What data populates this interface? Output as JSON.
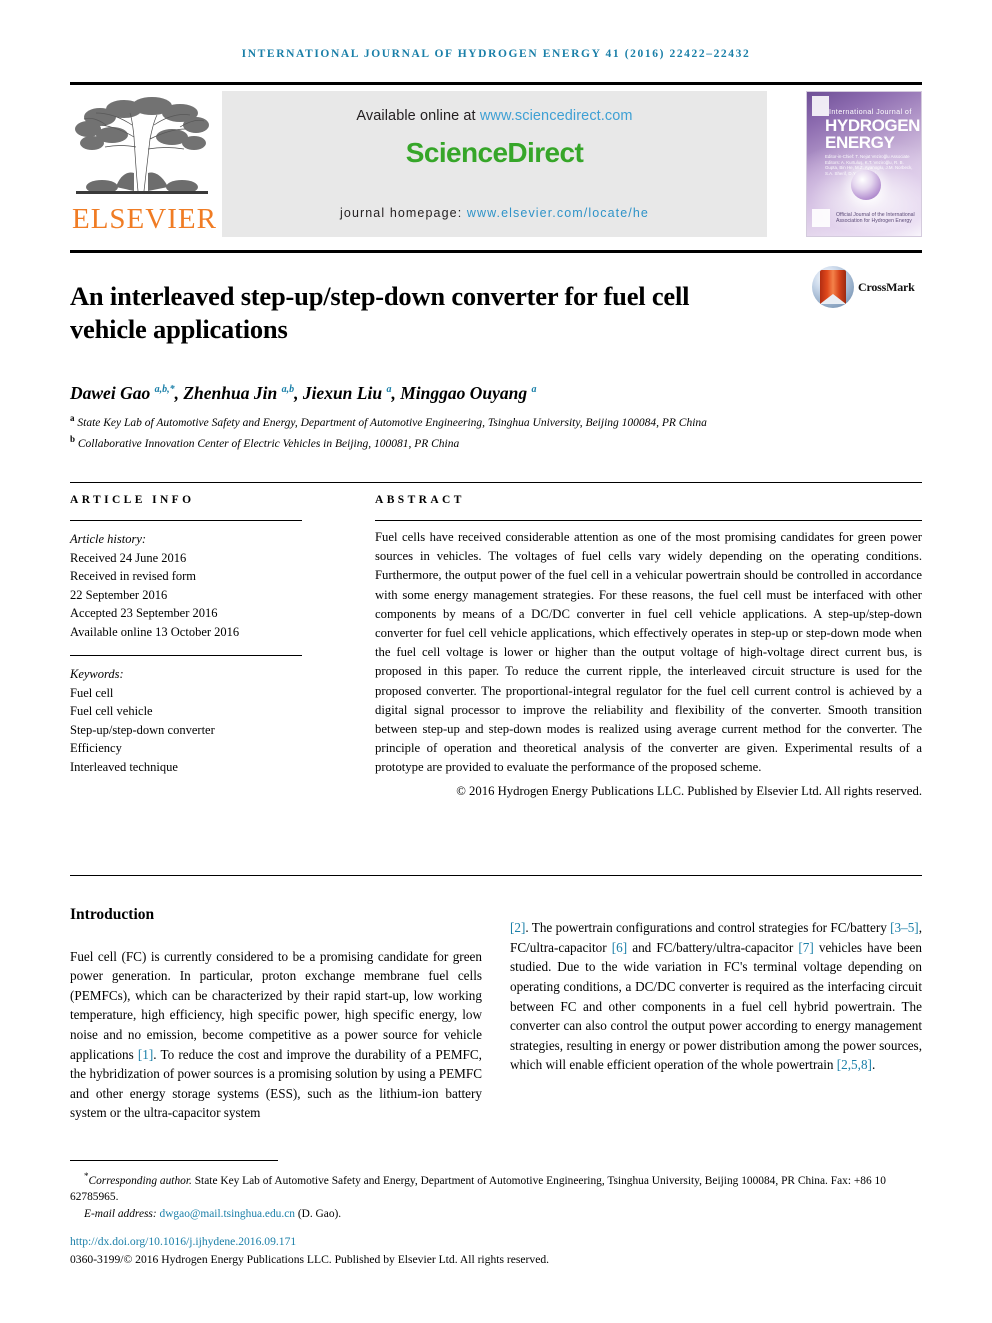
{
  "running_head": "INTERNATIONAL JOURNAL OF HYDROGEN ENERGY 41 (2016) 22422–22432",
  "masthead": {
    "publisher_logo_text": "ELSEVIER",
    "available_prefix": "Available online at ",
    "available_link": "www.sciencedirect.com",
    "sciencedirect_logo": "ScienceDirect",
    "homepage_prefix": "journal homepage: ",
    "homepage_link": "www.elsevier.com/locate/he",
    "cover": {
      "eyebrow": "International Journal of",
      "line1": "HYDROGEN",
      "line2": "ENERGY",
      "editors_block": "Editor-in-Chief: T. Nejat Veziroğlu\nAssociate Editors: A. Kurtuluş, K.T. Veziroğlu, R. B. Gupta, Bin He, M.Z. Ayanoglu, J.M. Norbeck, S.A. Sherif, D.Y. Goswami",
      "footer_text": "Official Journal of the International Association for Hydrogen Energy"
    }
  },
  "article": {
    "title": "An interleaved step-up/step-down converter for fuel cell vehicle applications",
    "crossmark_label": "CrossMark",
    "authors_html": "Dawei Gao <sup>a,b,*</sup>, Zhenhua Jin <sup>a,b</sup>, Jiexun Liu <sup>a</sup>, Minggao Ouyang <sup>a</sup>",
    "affiliations": [
      {
        "mark": "a",
        "text": "State Key Lab of Automotive Safety and Energy, Department of Automotive Engineering, Tsinghua University, Beijing 100084, PR China"
      },
      {
        "mark": "b",
        "text": "Collaborative Innovation Center of Electric Vehicles in Beijing, 100081, PR China"
      }
    ]
  },
  "article_info": {
    "heading": "ARTICLE INFO",
    "history_label": "Article history:",
    "history": [
      "Received 24 June 2016",
      "Received in revised form",
      "22 September 2016",
      "Accepted 23 September 2016",
      "Available online 13 October 2016"
    ],
    "keywords_label": "Keywords:",
    "keywords": [
      "Fuel cell",
      "Fuel cell vehicle",
      "Step-up/step-down converter",
      "Efficiency",
      "Interleaved technique"
    ]
  },
  "abstract": {
    "heading": "ABSTRACT",
    "body": "Fuel cells have received considerable attention as one of the most promising candidates for green power sources in vehicles. The voltages of fuel cells vary widely depending on the operating conditions. Furthermore, the output power of the fuel cell in a vehicular powertrain should be controlled in accordance with some energy management strategies. For these reasons, the fuel cell must be interfaced with other components by means of a DC/DC converter in fuel cell vehicle applications. A step-up/step-down converter for fuel cell vehicle applications, which effectively operates in step-up or step-down mode when the fuel cell voltage is lower or higher than the output voltage of high-voltage direct current bus, is proposed in this paper. To reduce the current ripple, the interleaved circuit structure is used for the proposed converter. The proportional-integral regulator for the fuel cell current control is achieved by a digital signal processor to improve the reliability and flexibility of the converter. Smooth transition between step-up and step-down modes is realized using average current method for the converter. The principle of operation and theoretical analysis of the converter are given. Experimental results of a prototype are provided to evaluate the performance of the proposed scheme.",
    "copyright": "© 2016 Hydrogen Energy Publications LLC. Published by Elsevier Ltd. All rights reserved."
  },
  "body": {
    "section_heading": "Introduction",
    "left_paragraph_part1": "Fuel cell (FC) is currently considered to be a promising candidate for green power generation. In particular, proton exchange membrane fuel cells (PEMFCs), which can be characterized by their rapid start-up, low working temperature, high efficiency, high specific power, high specific energy, low noise and no emission, become competitive as a power source for vehicle applications ",
    "ref1": "[1]",
    "left_paragraph_part2": ". To reduce the cost and improve the durability of a PEMFC, the hybridization of power sources is a promising solution by using a PEMFC and other energy storage systems (ESS), such as the lithium-ion battery system or the ultra-capacitor system ",
    "ref2": "[2]",
    "right_part2": ". The powertrain configurations and control strategies for FC/battery ",
    "ref3": "[3–5]",
    "right_part3": ", FC/ultra-capacitor ",
    "ref4": "[6]",
    "right_part4": " and FC/battery/ultra-capacitor ",
    "ref5": "[7]",
    "right_part5": " vehicles have been studied. Due to the wide variation in FC's terminal voltage depending on operating conditions, a DC/DC converter is required as the interfacing circuit between FC and other components in a fuel cell hybrid powertrain. The converter can also control the output power according to energy management strategies, resulting in energy or power distribution among the power sources, which will enable efficient operation of the whole powertrain ",
    "ref6": "[2,5,8]",
    "right_part6": "."
  },
  "footnote": {
    "star": "*",
    "corresponding_label": "Corresponding author.",
    "corresponding_text": " State Key Lab of Automotive Safety and Energy, Department of Automotive Engineering, Tsinghua University, Beijing 100084, PR China. Fax: +86 10 62785965.",
    "email_label": "E-mail address: ",
    "email_link": "dwgao@mail.tsinghua.edu.cn",
    "email_suffix": " (D. Gao).",
    "doi": "http://dx.doi.org/10.1016/j.ijhydene.2016.09.171",
    "issn_line": "0360-3199/© 2016 Hydrogen Energy Publications LLC. Published by Elsevier Ltd. All rights reserved."
  },
  "colors": {
    "link_blue": "#1a7fa8",
    "sciencedirect_green": "#36a629",
    "elsevier_orange": "#f07c24"
  }
}
